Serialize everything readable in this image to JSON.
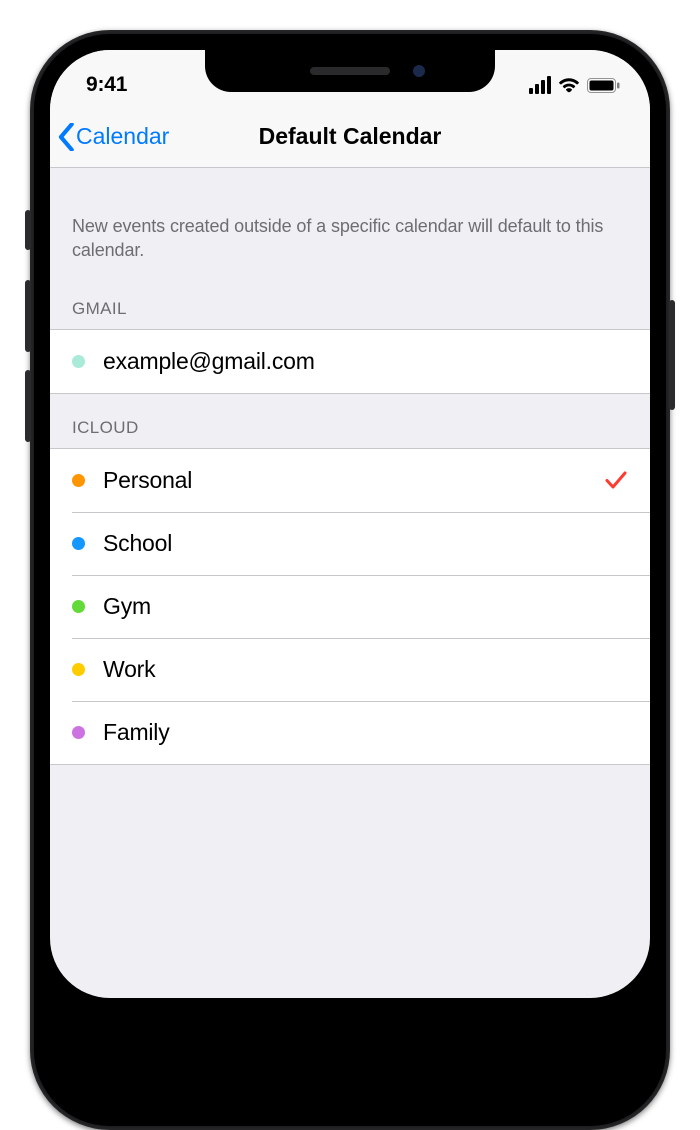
{
  "status": {
    "time": "9:41"
  },
  "nav": {
    "back_label": "Calendar",
    "title": "Default Calendar"
  },
  "description": "New events created outside of a specific calendar will default to this calendar.",
  "groups": [
    {
      "header": "GMAIL",
      "items": [
        {
          "label": "example@gmail.com",
          "dot_color": "#a9ead9",
          "selected": false
        }
      ]
    },
    {
      "header": "ICLOUD",
      "items": [
        {
          "label": "Personal",
          "dot_color": "#ff9500",
          "selected": true
        },
        {
          "label": "School",
          "dot_color": "#1497ff",
          "selected": false
        },
        {
          "label": "Gym",
          "dot_color": "#63da38",
          "selected": false
        },
        {
          "label": "Work",
          "dot_color": "#ffcc00",
          "selected": false
        },
        {
          "label": "Family",
          "dot_color": "#cc73e1",
          "selected": false
        }
      ]
    }
  ]
}
